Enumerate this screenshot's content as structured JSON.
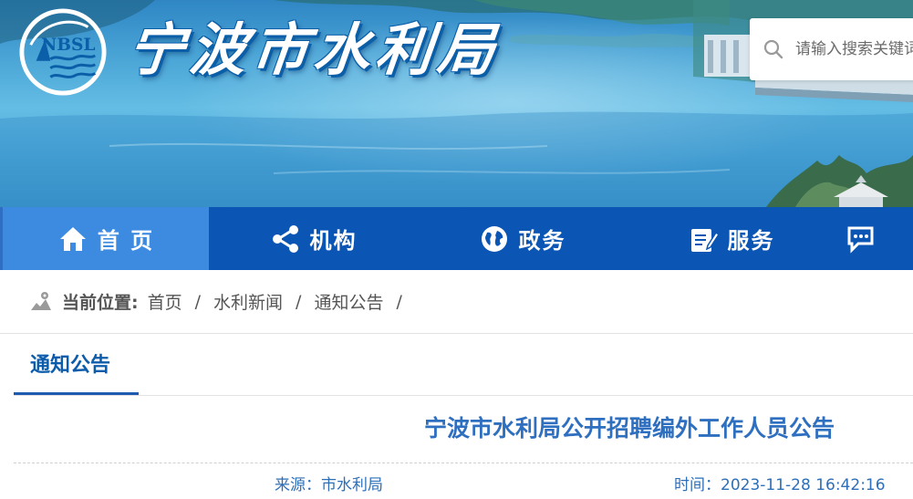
{
  "header": {
    "logo_text": "NBSL",
    "site_title": "宁波市水利局",
    "search": {
      "placeholder": "请输入搜索关键词"
    }
  },
  "nav": {
    "items": [
      {
        "label": "首 页",
        "icon": "home-icon",
        "active": true
      },
      {
        "label": "机构",
        "icon": "share-icon",
        "active": false
      },
      {
        "label": "政务",
        "icon": "globe-icon",
        "active": false
      },
      {
        "label": "服务",
        "icon": "form-icon",
        "active": false
      },
      {
        "label": "",
        "icon": "chat-icon",
        "active": false
      }
    ]
  },
  "breadcrumb": {
    "label": "当前位置:",
    "items": [
      "首页",
      "水利新闻",
      "通知公告"
    ],
    "separator": "/"
  },
  "section": {
    "tab_label": "通知公告"
  },
  "article": {
    "title": "宁波市水利局公开招聘编外工作人员公告",
    "source": "来源：市水利局",
    "time": "时间：2023-11-28 16:42:16"
  },
  "colors": {
    "nav_bg": "#0b56b4",
    "nav_active": "#3d8be0",
    "title_blue": "#2f6fc0",
    "tab_blue": "#0c5cab"
  }
}
